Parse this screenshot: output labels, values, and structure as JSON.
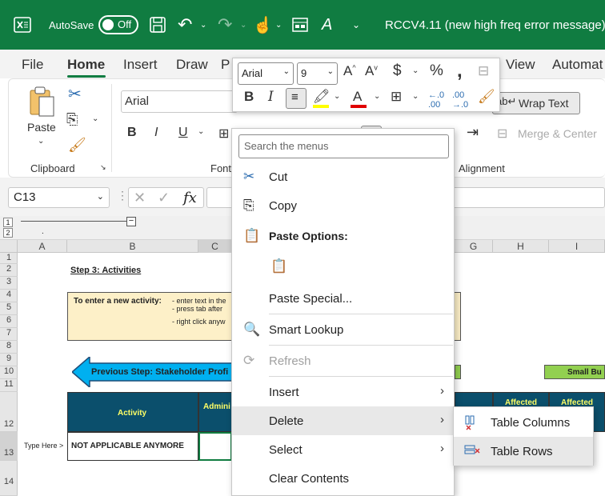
{
  "titlebar": {
    "autosave_label": "AutoSave",
    "autosave_state": "Off",
    "title": "RCCV4.11 (new high freq error message)"
  },
  "tabs": [
    "File",
    "Home",
    "Insert",
    "Draw",
    "P",
    "View",
    "Automat"
  ],
  "ribbon": {
    "paste_label": "Paste",
    "clipboard_label": "Clipboard",
    "font_group_label": "Font",
    "font_name": "Arial",
    "alignment_label": "Alignment",
    "wrap_text": "Wrap Text",
    "merge_center": "Merge & Center"
  },
  "formula_bar": {
    "name_box": "C13",
    "fx": "fx"
  },
  "outline": {
    "level1": "1",
    "level2": "2"
  },
  "columns": [
    "A",
    "B",
    "C",
    "G",
    "H",
    "I"
  ],
  "rows": [
    "1",
    "2",
    "3",
    "4",
    "5",
    "6",
    "7",
    "8",
    "9",
    "10",
    "11",
    "12",
    "13",
    "14"
  ],
  "sheet": {
    "step_title": "Step 3: Activities",
    "new_activity_label": "To enter a new activity:",
    "instr1": "- enter text in the",
    "instr2": "- press tab after",
    "instr3": "- right click anyw",
    "prev_step": "Previous Step: Stakeholder Profi",
    "small_bu": "Small Bu",
    "activity_header": "Activity",
    "admin_header": "Admini or Com",
    "affected1": "Affected",
    "affected2": "Affected",
    "type_here": "Type Here >",
    "not_applicable": "NOT APPLICABLE ANYMORE"
  },
  "mini_toolbar": {
    "font": "Arial",
    "size": "9"
  },
  "context_menu": {
    "search_placeholder": "Search the menus",
    "cut": "Cut",
    "copy": "Copy",
    "paste_options": "Paste Options:",
    "paste_special": "Paste Special...",
    "smart_lookup": "Smart Lookup",
    "refresh": "Refresh",
    "insert": "Insert",
    "delete": "Delete",
    "select": "Select",
    "clear_contents": "Clear Contents"
  },
  "submenu": {
    "table_columns": "Table Columns",
    "table_rows": "Table Rows"
  },
  "colors": {
    "excel_green": "#107c41",
    "header_blue": "#0b4f6c",
    "header_yellow": "#ffff66",
    "light_green": "#92d050",
    "arrow_blue": "#00b0f0"
  }
}
